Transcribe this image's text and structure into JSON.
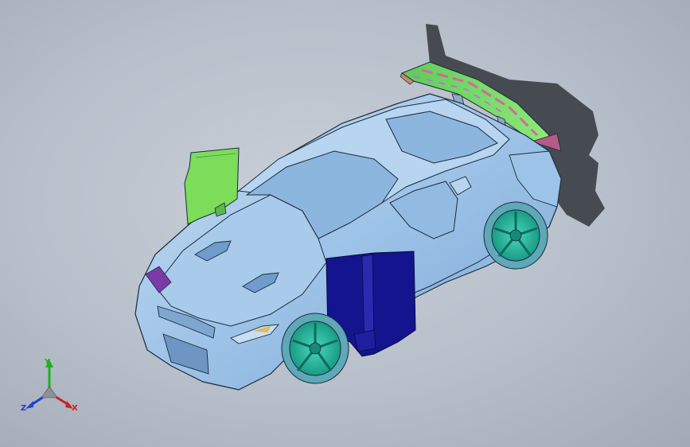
{
  "viewport": {
    "background_top": "#c9cfd8",
    "background_bottom": "#a2aab6"
  },
  "model": {
    "body_color": "#9ec3e8",
    "body_shade": "#7aa6d4",
    "body_highlight": "#c7def3",
    "outline_color": "#1b2a3a",
    "wheel_color": "#2fc4a8",
    "wheel_dark": "#168a77",
    "tire_color": "#5ea8b8",
    "left_door_color": "#7ddc5a",
    "right_door_color": "#14148f",
    "wing_color": "#6bdc6a",
    "wing_stripe_color": "#d46a9a",
    "shadow_color": "#3a3e44"
  },
  "triad": {
    "x_label": "X",
    "y_label": "Y",
    "z_label": "Z",
    "x_color": "#d02020",
    "y_color": "#20b020",
    "z_color": "#2040d0"
  }
}
